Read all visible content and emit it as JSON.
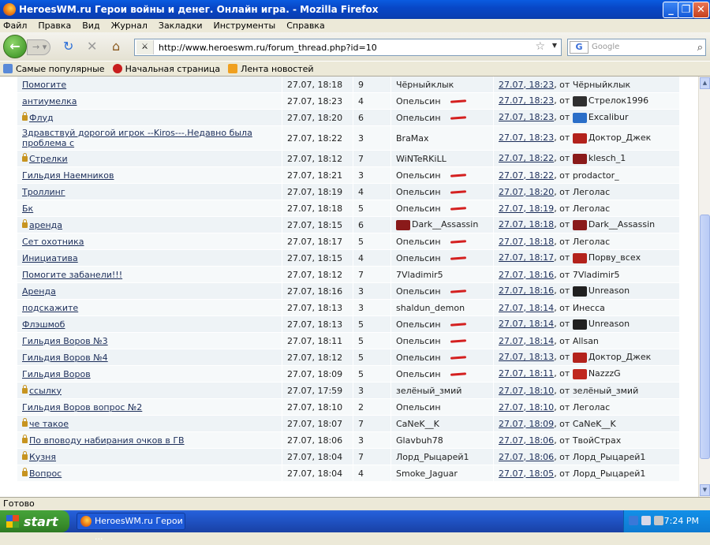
{
  "window": {
    "title": "HeroesWM.ru Герои войны и денег. Онлайн игра. - Mozilla Firefox"
  },
  "menu": [
    "Файл",
    "Правка",
    "Вид",
    "Журнал",
    "Закладки",
    "Инструменты",
    "Справка"
  ],
  "nav": {
    "url": "http://www.heroeswm.ru/forum_thread.php?id=10",
    "search_placeholder": "Google"
  },
  "bookmarks": [
    "Самые популярные",
    "Начальная страница",
    "Лента новостей"
  ],
  "threads": [
    {
      "title": "Помогите",
      "locked": false,
      "date": "27.07, 18:18",
      "count": "9",
      "author": "Чёрныйклык",
      "author_clan": "",
      "author_flag": false,
      "last_date": "27.07, 18:23",
      "last_by": "Чёрныйклык",
      "last_clan": ""
    },
    {
      "title": "антиумелка",
      "locked": false,
      "date": "27.07, 18:23",
      "count": "4",
      "author": "Опельсин",
      "author_clan": "",
      "author_flag": true,
      "last_date": "27.07, 18:23",
      "last_by": "Стрелок1996",
      "last_clan": "#303030"
    },
    {
      "title": "Флуд",
      "locked": true,
      "date": "27.07, 18:20",
      "count": "6",
      "author": "Опельсин",
      "author_clan": "",
      "author_flag": true,
      "last_date": "27.07, 18:23",
      "last_by": "Excalibur",
      "last_clan": "#2a6ec8"
    },
    {
      "title": "Здравствуй дорогой игрок --Kiros---.Недавно была проблема с",
      "locked": false,
      "date": "27.07, 18:22",
      "count": "3",
      "author": "BraMax",
      "author_clan": "",
      "author_flag": false,
      "last_date": "27.07, 18:23",
      "last_by": "Доктор_Джек",
      "last_clan": "#b3221c"
    },
    {
      "title": "Стрелки",
      "locked": true,
      "date": "27.07, 18:12",
      "count": "7",
      "author": "WiNTeRKiLL",
      "author_clan": "",
      "author_flag": false,
      "last_date": "27.07, 18:22",
      "last_by": "klesch_1",
      "last_clan": "#8a1a1a"
    },
    {
      "title": "Гильдия Наемников",
      "locked": false,
      "date": "27.07, 18:21",
      "count": "3",
      "author": "Опельсин",
      "author_clan": "",
      "author_flag": true,
      "last_date": "27.07, 18:22",
      "last_by": "prodactor_",
      "last_clan": ""
    },
    {
      "title": "Троллинг",
      "locked": false,
      "date": "27.07, 18:19",
      "count": "4",
      "author": "Опельсин",
      "author_clan": "",
      "author_flag": true,
      "last_date": "27.07, 18:20",
      "last_by": "Леголас",
      "last_clan": ""
    },
    {
      "title": "Бк",
      "locked": false,
      "date": "27.07, 18:18",
      "count": "5",
      "author": "Опельсин",
      "author_clan": "",
      "author_flag": true,
      "last_date": "27.07, 18:19",
      "last_by": "Леголас",
      "last_clan": ""
    },
    {
      "title": "аренда",
      "locked": true,
      "date": "27.07, 18:15",
      "count": "6",
      "author": "Dark__Assassin",
      "author_clan": "#8a1a1a",
      "author_flag": false,
      "last_date": "27.07, 18:18",
      "last_by": "Dark__Assassin",
      "last_clan": "#8a1a1a"
    },
    {
      "title": "Сет охотника",
      "locked": false,
      "date": "27.07, 18:17",
      "count": "5",
      "author": "Опельсин",
      "author_clan": "",
      "author_flag": true,
      "last_date": "27.07, 18:18",
      "last_by": "Леголас",
      "last_clan": ""
    },
    {
      "title": "Инициатива",
      "locked": false,
      "date": "27.07, 18:15",
      "count": "4",
      "author": "Опельсин",
      "author_clan": "",
      "author_flag": true,
      "last_date": "27.07, 18:17",
      "last_by": "Порву_всех",
      "last_clan": "#b3221c"
    },
    {
      "title": "Помогите забанели!!!",
      "locked": false,
      "date": "27.07, 18:12",
      "count": "7",
      "author": "7Vladimir5",
      "author_clan": "",
      "author_flag": false,
      "last_date": "27.07, 18:16",
      "last_by": "7Vladimir5",
      "last_clan": ""
    },
    {
      "title": "Аренда",
      "locked": false,
      "date": "27.07, 18:16",
      "count": "3",
      "author": "Опельсин",
      "author_clan": "",
      "author_flag": true,
      "last_date": "27.07, 18:16",
      "last_by": "Unreason",
      "last_clan": "#202020"
    },
    {
      "title": "подскажите",
      "locked": false,
      "date": "27.07, 18:13",
      "count": "3",
      "author": "shaldun_demon",
      "author_clan": "",
      "author_flag": false,
      "last_date": "27.07, 18:14",
      "last_by": "Инесса",
      "last_clan": ""
    },
    {
      "title": "Флэшмоб",
      "locked": false,
      "date": "27.07, 18:13",
      "count": "5",
      "author": "Опельсин",
      "author_clan": "",
      "author_flag": true,
      "last_date": "27.07, 18:14",
      "last_by": "Unreason",
      "last_clan": "#202020"
    },
    {
      "title": "Гильдия Воров №3",
      "locked": false,
      "date": "27.07, 18:11",
      "count": "5",
      "author": "Опельсин",
      "author_clan": "",
      "author_flag": true,
      "last_date": "27.07, 18:14",
      "last_by": "Allsan",
      "last_clan": ""
    },
    {
      "title": "Гильдия Воров №4",
      "locked": false,
      "date": "27.07, 18:12",
      "count": "5",
      "author": "Опельсин",
      "author_clan": "",
      "author_flag": true,
      "last_date": "27.07, 18:13",
      "last_by": "Доктор_Джек",
      "last_clan": "#b3221c"
    },
    {
      "title": "Гильдия Воров",
      "locked": false,
      "date": "27.07, 18:09",
      "count": "5",
      "author": "Опельсин",
      "author_clan": "",
      "author_flag": true,
      "last_date": "27.07, 18:11",
      "last_by": "NazzzG",
      "last_clan": "#c0281e"
    },
    {
      "title": "ссылку",
      "locked": true,
      "date": "27.07, 17:59",
      "count": "3",
      "author": "зелёный_змий",
      "author_clan": "",
      "author_flag": false,
      "last_date": "27.07, 18:10",
      "last_by": "зелёный_змий",
      "last_clan": ""
    },
    {
      "title": "Гильдия Воров вопрос №2",
      "locked": false,
      "date": "27.07, 18:10",
      "count": "2",
      "author": "Опельсин",
      "author_clan": "",
      "author_flag": false,
      "last_date": "27.07, 18:10",
      "last_by": "Леголас",
      "last_clan": ""
    },
    {
      "title": "че такое",
      "locked": true,
      "date": "27.07, 18:07",
      "count": "7",
      "author": "CaNeK__K",
      "author_clan": "",
      "author_flag": false,
      "last_date": "27.07, 18:09",
      "last_by": "CaNeK__K",
      "last_clan": ""
    },
    {
      "title": "По вповоду набирания очков в ГВ",
      "locked": true,
      "date": "27.07, 18:06",
      "count": "3",
      "author": "Glavbuh78",
      "author_clan": "",
      "author_flag": false,
      "last_date": "27.07, 18:06",
      "last_by": "ТвойСтрах",
      "last_clan": ""
    },
    {
      "title": "Кузня",
      "locked": true,
      "date": "27.07, 18:04",
      "count": "7",
      "author": "Лорд_Рыцарей1",
      "author_clan": "",
      "author_flag": false,
      "last_date": "27.07, 18:06",
      "last_by": "Лорд_Рыцарей1",
      "last_clan": ""
    },
    {
      "title": "Вопрос",
      "locked": true,
      "date": "27.07, 18:04",
      "count": "4",
      "author": "Smoke_Jaguar",
      "author_clan": "",
      "author_flag": false,
      "last_date": "27.07, 18:05",
      "last_by": "Лорд_Рыцарей1",
      "last_clan": ""
    }
  ],
  "labels": {
    "from": "от"
  },
  "status": "Готово",
  "taskbar": {
    "start": "start",
    "item": "HeroesWM.ru Герои ...",
    "clock": "7:24 PM"
  }
}
